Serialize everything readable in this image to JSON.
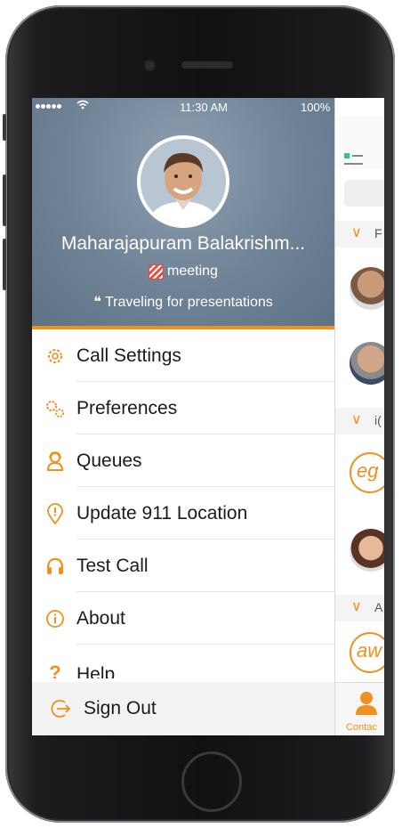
{
  "status_bar": {
    "time": "11:30 AM",
    "battery": "100%"
  },
  "profile": {
    "name": "Maharajapuram Balakrishm...",
    "presence": "meeting",
    "status_message": "❝ Traveling for presentations"
  },
  "menu": {
    "items": [
      {
        "label": "Call Settings",
        "icon": "gear-icon"
      },
      {
        "label": "Preferences",
        "icon": "gears-icon"
      },
      {
        "label": "Queues",
        "icon": "agent-icon"
      },
      {
        "label": "Update 911 Location",
        "icon": "location-pin-icon"
      },
      {
        "label": "Test Call",
        "icon": "headset-icon"
      },
      {
        "label": "About",
        "icon": "info-icon"
      },
      {
        "label": "Help",
        "icon": "question-icon"
      }
    ],
    "sign_out": "Sign Out"
  },
  "background_app": {
    "sections": [
      "F",
      "i(",
      "A"
    ],
    "ring_avatars": [
      "eg",
      "aw"
    ],
    "tab_label": "Contac"
  },
  "colors": {
    "accent": "#f0901e",
    "header_bg": "#6f8296"
  }
}
